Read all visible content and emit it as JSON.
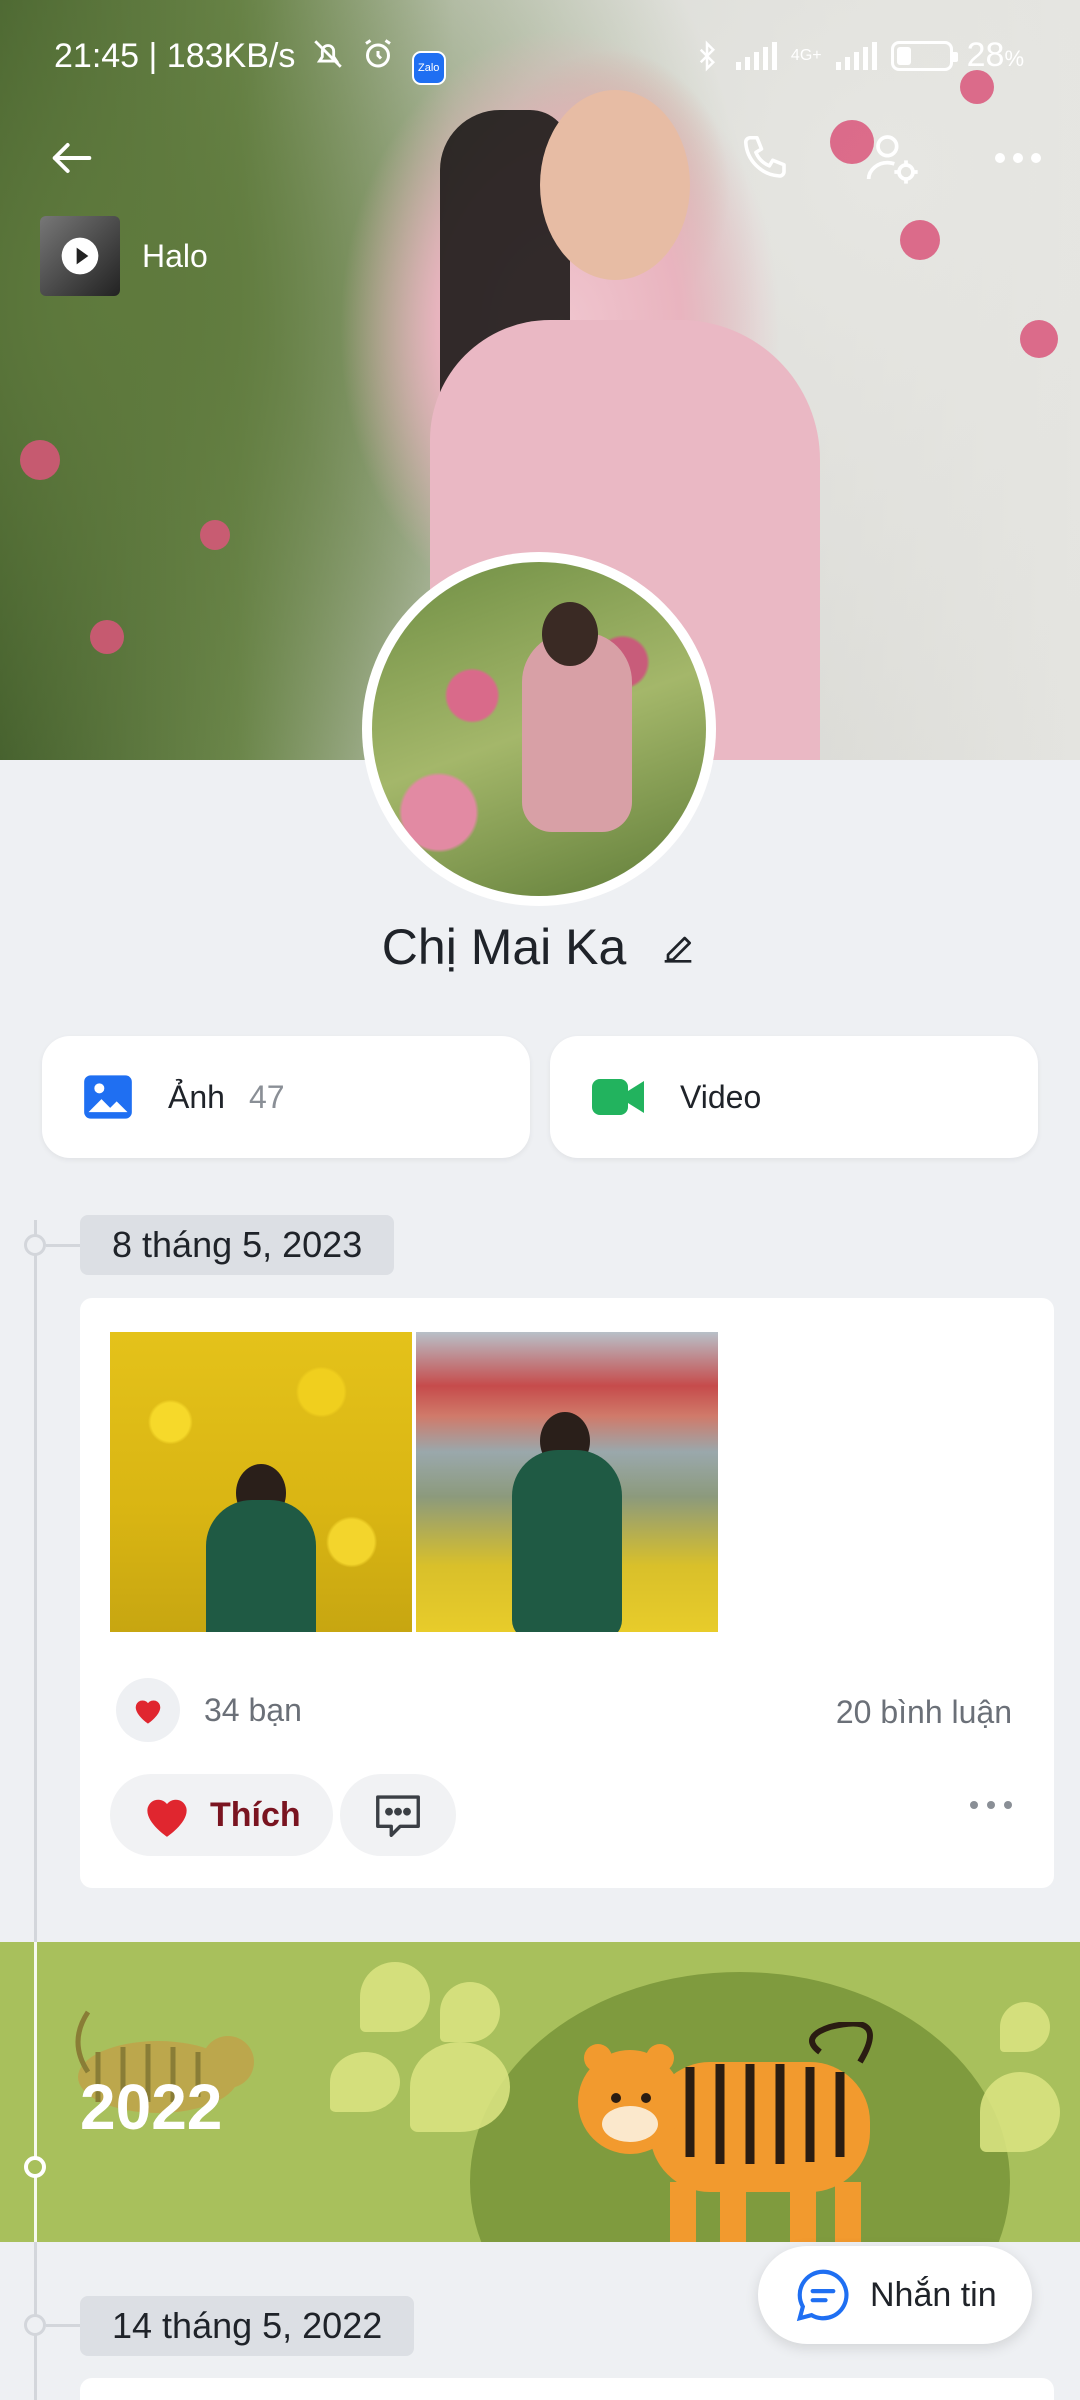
{
  "status_bar": {
    "time_speed": "21:45 | 183KB/s",
    "network": "4G+",
    "battery": "28",
    "battery_unit": "%"
  },
  "music": {
    "title": "Halo"
  },
  "profile": {
    "name": "Chị Mai Ka"
  },
  "media": {
    "photos_label": "Ảnh",
    "photos_count": "47",
    "video_label": "Video"
  },
  "timeline": {
    "entries": [
      {
        "date": "8 tháng 5, 2023",
        "likes_text": "34 bạn",
        "comments_text": "20 bình luận",
        "like_button_label": "Thích"
      }
    ],
    "year_banner": "2022",
    "next_date": "14 tháng 5, 2022"
  },
  "fab": {
    "label": "Nhắn tin"
  },
  "colors": {
    "accent_blue": "#1f6ff2",
    "video_green": "#22b35e",
    "like_red": "#e0262f",
    "banner_green": "#a8c05c"
  },
  "icons": [
    "back-arrow-icon",
    "phone-icon",
    "user-settings-icon",
    "more-icon",
    "play-icon",
    "edit-icon",
    "image-icon",
    "video-camera-icon",
    "heart-icon",
    "comment-icon",
    "chat-icon"
  ]
}
